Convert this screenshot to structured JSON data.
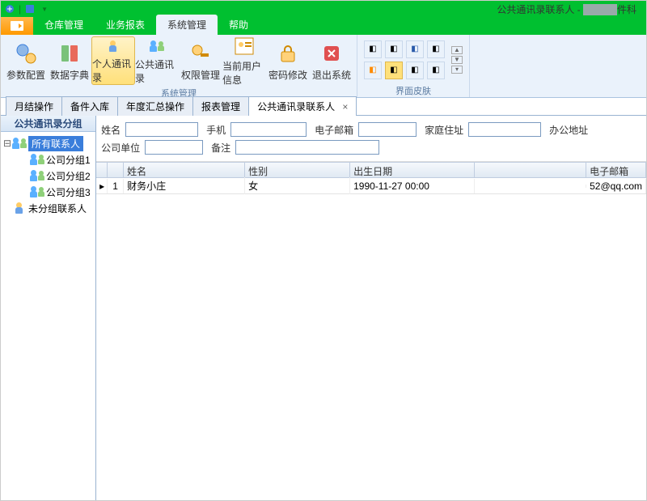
{
  "titlebar": {
    "title": "公共通讯录联系人 - ",
    "title_suffix": "件科"
  },
  "ribbon": {
    "tabs": [
      "仓库管理",
      "业务报表",
      "系统管理",
      "帮助"
    ],
    "active_tab_index": 2,
    "group1": {
      "caption": "系统管理",
      "buttons": [
        {
          "label": "参数配置"
        },
        {
          "label": "数据字典"
        },
        {
          "label": "个人通讯录",
          "active": true
        },
        {
          "label": "公共通讯录"
        },
        {
          "label": "权限管理"
        },
        {
          "label": "当前用户信息"
        },
        {
          "label": "密码修改"
        },
        {
          "label": "退出系统"
        }
      ]
    },
    "group2": {
      "caption": "界面皮肤"
    }
  },
  "doc_tabs": {
    "items": [
      "月结操作",
      "备件入库",
      "年度汇总操作",
      "报表管理",
      "公共通讯录联系人"
    ],
    "active_index": 4
  },
  "sidebar": {
    "header": "公共通讯录分组",
    "root": {
      "label": "所有联系人",
      "selected": true
    },
    "children": [
      {
        "label": "公司分组1"
      },
      {
        "label": "公司分组2"
      },
      {
        "label": "公司分组3"
      }
    ],
    "ungrouped": {
      "label": "未分组联系人"
    }
  },
  "form": {
    "labels": {
      "name": "姓名",
      "mobile": "手机",
      "email": "电子邮箱",
      "home_addr": "家庭住址",
      "office_addr": "办公地址",
      "company": "公司单位",
      "remark": "备注"
    },
    "values": {
      "name": "",
      "mobile": "",
      "email": "",
      "home_addr": "",
      "office_addr": "",
      "company": "",
      "remark": ""
    }
  },
  "grid": {
    "columns": [
      "姓名",
      "性别",
      "出生日期",
      "",
      "电子邮箱"
    ],
    "rows": [
      {
        "num": "1",
        "name": "财务小庄",
        "sex": "女",
        "birth": "1990-11-27 00:00",
        "phone": "",
        "email": "52@qq.com"
      }
    ]
  }
}
